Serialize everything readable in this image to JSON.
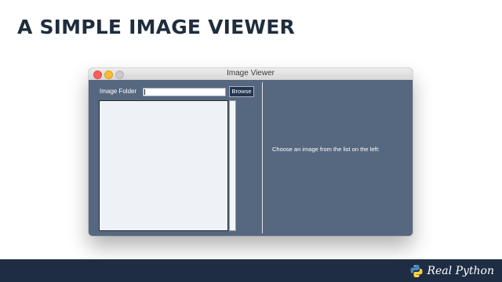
{
  "slide": {
    "title": "A SIMPLE IMAGE VIEWER"
  },
  "window": {
    "title": "Image Viewer",
    "folder_label": "Image Folder",
    "folder_value": "",
    "browse_label": "Browse",
    "prompt": "Choose an image from the list on the left:",
    "file_list": []
  },
  "footer": {
    "brand": "Real Python",
    "brand_icon": "python-logo-icon"
  },
  "colors": {
    "window_bg": "#56687f",
    "button_bg": "#253650",
    "footer_bg": "#1f2d44",
    "title_text": "#1f2d3d"
  }
}
